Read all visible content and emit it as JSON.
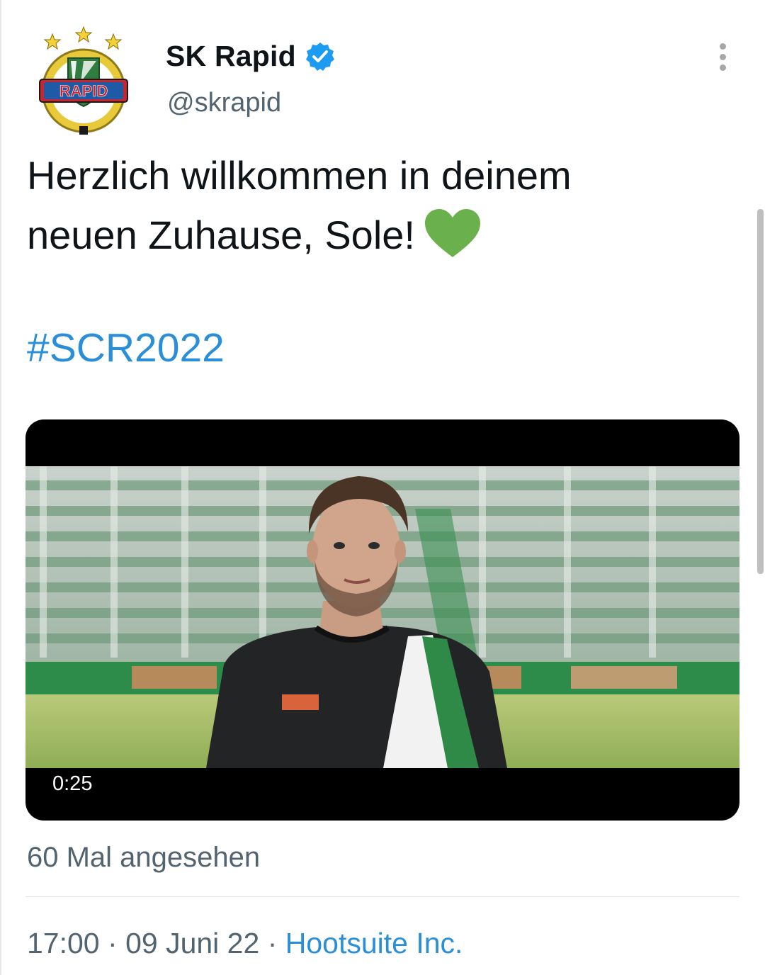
{
  "tweet": {
    "display_name": "SK Rapid",
    "handle": "@skrapid",
    "verified": true,
    "avatar_icon": "sk-rapid-crest-logo",
    "avatar_logo_text": "RAPID",
    "text_line1": "Herzlich willkommen in deinem",
    "text_line2": "neuen Zuhause, Sole!",
    "emoji": "green-heart-icon",
    "hashtag": "#SCR2022",
    "video": {
      "duration": "0:25"
    },
    "views": "60 Mal angesehen",
    "time": "17:00",
    "separator": "·",
    "date": "09 Juni 22",
    "source": "Hootsuite Inc."
  },
  "colors": {
    "link": "#2a8fd8",
    "secondary_text": "#536471",
    "heart": "#6ab04c",
    "verified_badge": "#1d9bf0"
  }
}
